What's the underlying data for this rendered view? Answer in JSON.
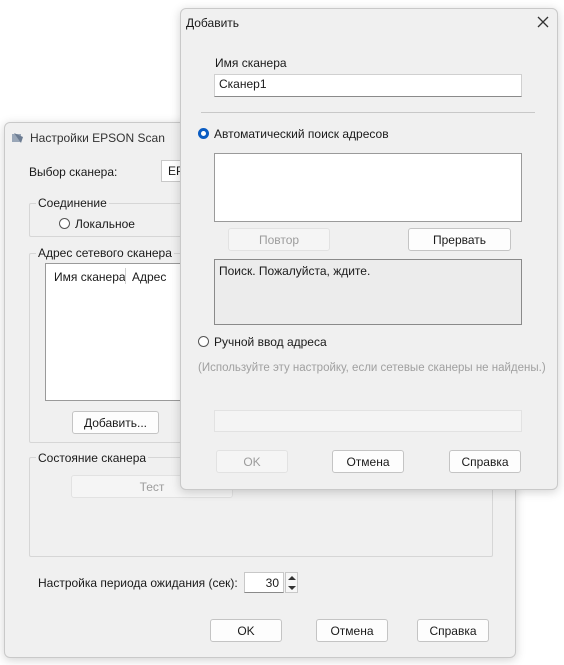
{
  "main_window": {
    "title": "Настройки EPSON Scan",
    "scanner_select_label": "Выбор сканера:",
    "scanner_select_value": "EP",
    "connection_group": "Соединение",
    "connection_local": "Локальное",
    "address_group": "Адрес сетевого сканера",
    "address_columns": [
      "Имя сканера",
      "Адрес"
    ],
    "add_button": "Добавить...",
    "status_group": "Состояние сканера",
    "test_button": "Тест",
    "timeout_label": "Настройка периода ожидания (сек):",
    "timeout_value": "30",
    "ok_button": "OK",
    "cancel_button": "Отмена",
    "help_button": "Справка"
  },
  "add_dialog": {
    "title": "Добавить",
    "scanner_name_label": "Имя сканера",
    "scanner_name_value": "Сканер1",
    "auto_search_label": "Автоматический поиск адресов",
    "auto_search_checked": true,
    "retry_button": "Повтор",
    "stop_button": "Прервать",
    "status_text": "Поиск. Пожалуйста, ждите.",
    "manual_label": "Ручной ввод адреса",
    "manual_hint": "(Используйте эту настройку, если сетевые сканеры не найдены.)",
    "ok_button": "OK",
    "cancel_button": "Отмена",
    "help_button": "Справка"
  }
}
